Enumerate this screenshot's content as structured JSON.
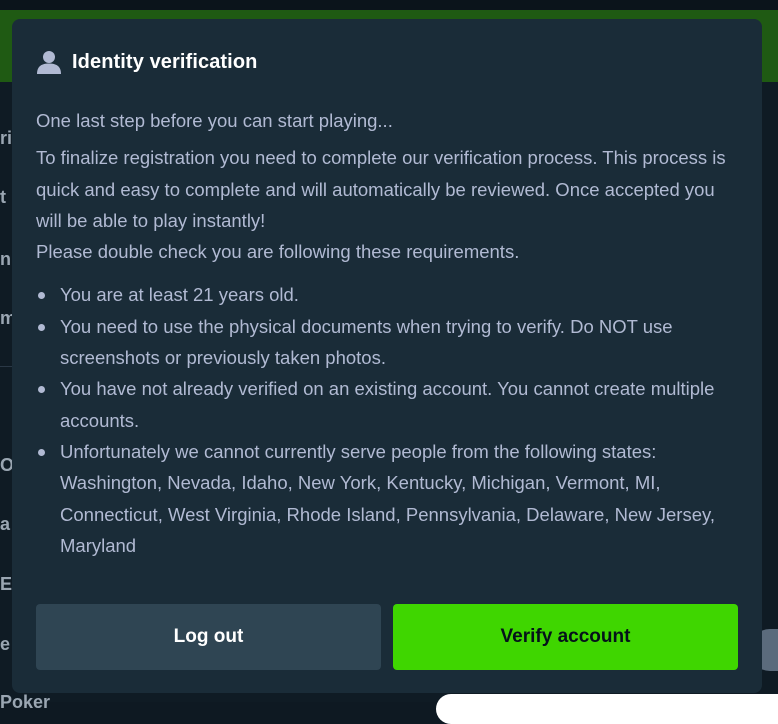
{
  "background": {
    "sidebar_fragments": [
      "ri",
      "t",
      "n",
      "m",
      "O",
      "a",
      "E",
      "e",
      "Poker"
    ]
  },
  "modal": {
    "icon": "user-icon",
    "title": "Identity verification",
    "intro": "One last step before you can start playing...",
    "paragraphs": [
      "To finalize registration you need to complete our verification process. This process is quick and easy to complete and will automatically be reviewed. Once accepted you will be able to play instantly!",
      "Please double check you are following these requirements."
    ],
    "requirements": [
      "You are at least 21 years old.",
      "You need to use the physical documents when trying to verify. Do NOT use screenshots or previously taken photos.",
      "You have not already verified on an existing account. You cannot create multiple accounts.",
      "Unfortunately we cannot currently serve people from the following states: Washington, Nevada, Idaho, New York, Kentucky, Michigan, Vermont, MI, Connecticut, West Virginia, Rhode Island, Pennsylvania, Delaware, New Jersey, Maryland"
    ],
    "buttons": {
      "logout_label": "Log out",
      "verify_label": "Verify account"
    }
  },
  "colors": {
    "modal_bg": "#1a2c38",
    "text_primary": "#ffffff",
    "text_secondary": "#b1bad3",
    "logout_bg": "#2f4553",
    "verify_bg": "#3fd600"
  }
}
